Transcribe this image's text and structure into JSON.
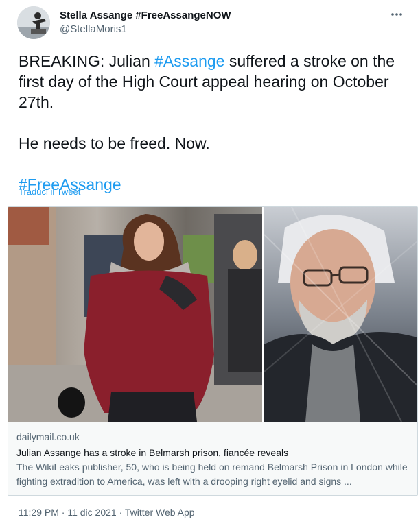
{
  "author": {
    "display_name": "Stella Assange #FreeAssangeNOW",
    "handle": "@StellaMoris1"
  },
  "tweet": {
    "line1_prefix": "BREAKING: Julian ",
    "line1_hashtag": "#Assange",
    "line1_suffix": " suffered a stroke on the first day of the High Court appeal hearing on October 27th.",
    "line2": "He needs to be freed. Now.",
    "hashtag": "#FreeAssange",
    "translate_label": "Traduci il Tweet"
  },
  "card": {
    "domain": "dailymail.co.uk",
    "title": "Julian Assange has a stroke in Belmarsh prison, fiancée reveals",
    "description": "The WikiLeaks publisher, 50, who is being held on remand Belmarsh Prison in London while fighting extradition to America, was left with a drooping right eyelid and signs ..."
  },
  "meta": {
    "time": "11:29 PM",
    "sep1": " · ",
    "date": "11 dic 2021",
    "sep2": " · ",
    "source": "Twitter Web App"
  },
  "icons": {
    "more": "more-horizontal-icon"
  },
  "colors": {
    "link": "#1d9bf0",
    "text": "#0f1419",
    "secondary": "#536471",
    "coat": "#8a1f2c"
  }
}
